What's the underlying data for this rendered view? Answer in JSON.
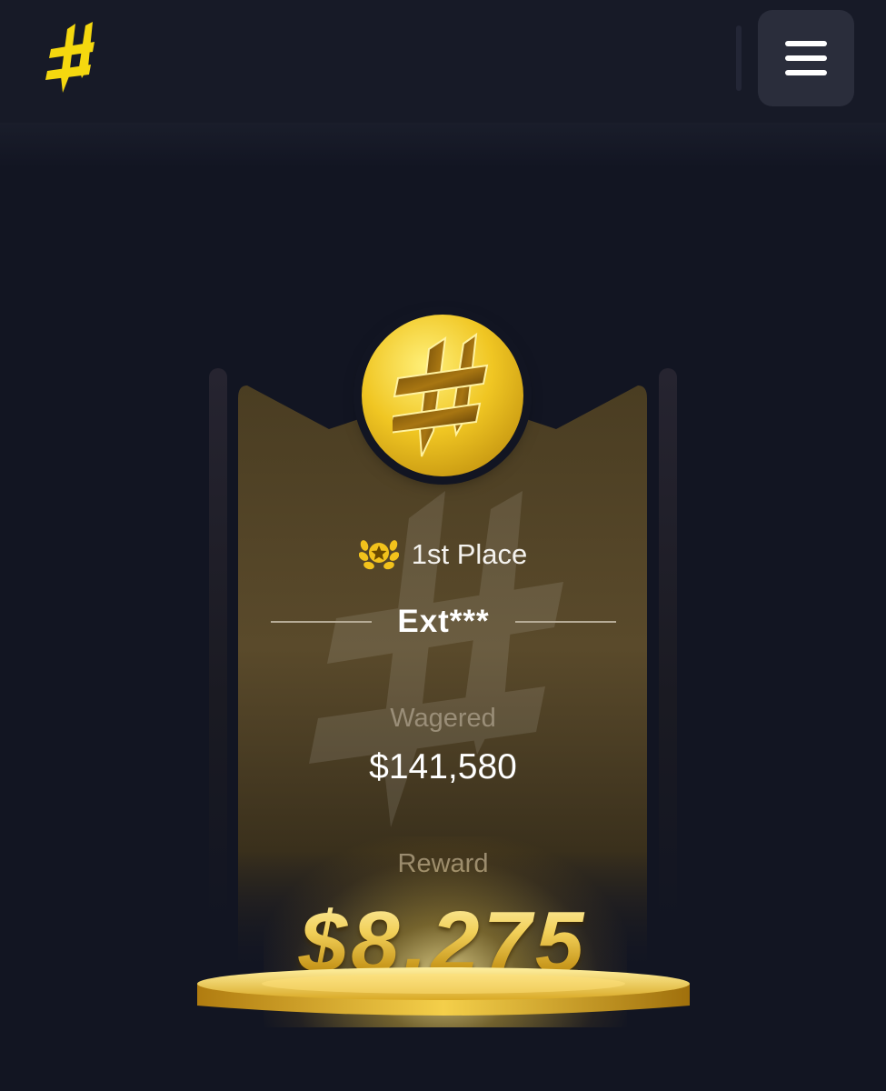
{
  "header": {
    "logo_icon": "hashtag-logo-icon",
    "menu_icon": "hamburger-menu-icon"
  },
  "card": {
    "badge_icon": "laurel-star-icon",
    "place": "1st Place",
    "username": "Ext***",
    "wagered_label": "Wagered",
    "wagered_value": "$141,580",
    "reward_label": "Reward",
    "reward_value": "$8,275"
  },
  "colors": {
    "background": "#121522",
    "header": "#171a27",
    "accent_yellow": "#f5d80f",
    "gold": "#e8c34a",
    "card_brown": "#5a4a2a"
  }
}
